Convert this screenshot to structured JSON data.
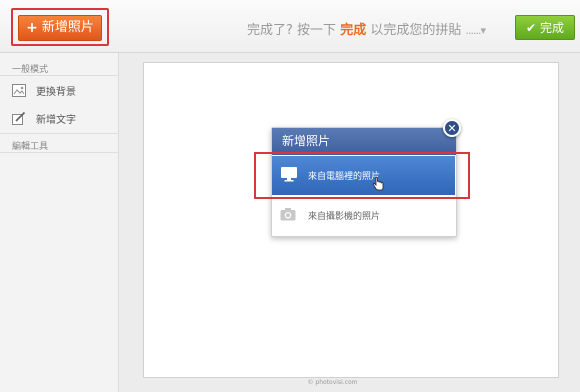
{
  "toolbar": {
    "add_photo_label": "新增照片",
    "hint_prefix": "完成了? 按一下",
    "hint_emphasis": "完成",
    "hint_suffix": "以完成您的拼貼",
    "hint_dots": "......▾",
    "done_label": "完成"
  },
  "sidebar": {
    "section_general": "一般模式",
    "items": [
      {
        "label": "更換背景",
        "icon": "image-icon"
      },
      {
        "label": "新增文字",
        "icon": "edit-pencil-icon"
      }
    ],
    "section_edit_tools": "編輯工具"
  },
  "popup": {
    "title": "新增照片",
    "option_computer": "來自電腦裡的照片",
    "option_camera": "來自攝影機的照片"
  },
  "watermark": "© photovisi.com",
  "colors": {
    "accent_orange": "#e0561b",
    "done_green": "#5faa1d",
    "popup_blue": "#3d5f9e",
    "highlight_red": "#d9373b"
  }
}
